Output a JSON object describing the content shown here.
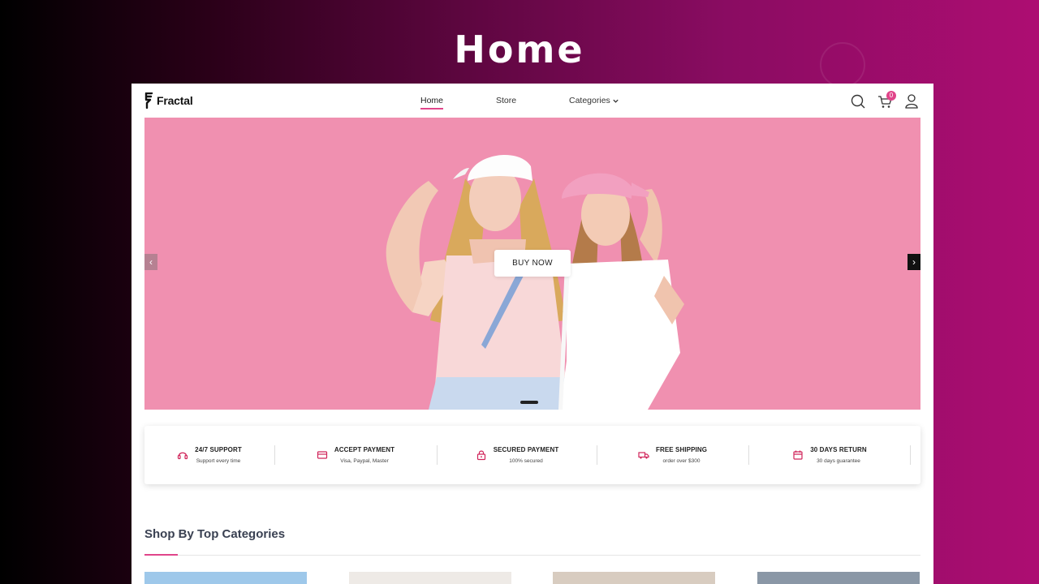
{
  "page_heading": "Home",
  "brand": {
    "name": "Fractal",
    "accent_color": "#e0458a"
  },
  "nav": {
    "links": [
      {
        "label": "Home",
        "active": true
      },
      {
        "label": "Store",
        "active": false
      },
      {
        "label": "Categories",
        "active": false
      }
    ],
    "icons": [
      "search-icon",
      "cart-icon",
      "user-icon"
    ],
    "cart_count": "0"
  },
  "hero": {
    "button_label": "BUY NOW",
    "prev_arrow": "‹",
    "next_arrow": "›",
    "background_color": "#f090b0"
  },
  "features": [
    {
      "icon": "headset-icon",
      "title": "24/7 SUPPORT",
      "subtitle": "Support every time"
    },
    {
      "icon": "credit-card-icon",
      "title": "ACCEPT PAYMENT",
      "subtitle": "Visa, Paypal, Master"
    },
    {
      "icon": "lock-icon",
      "title": "SECURED PAYMENT",
      "subtitle": "100% secured"
    },
    {
      "icon": "truck-icon",
      "title": "FREE SHIPPING",
      "subtitle": "order over $300"
    },
    {
      "icon": "calendar-icon",
      "title": "30 DAYS RETURN",
      "subtitle": "30 days guarantee"
    }
  ],
  "categories_section": {
    "title": "Shop By Top Categories",
    "thumb_colors": [
      "#9ec8ea",
      "#eeeae6",
      "#d8ccc0",
      "#8a97a6"
    ]
  }
}
